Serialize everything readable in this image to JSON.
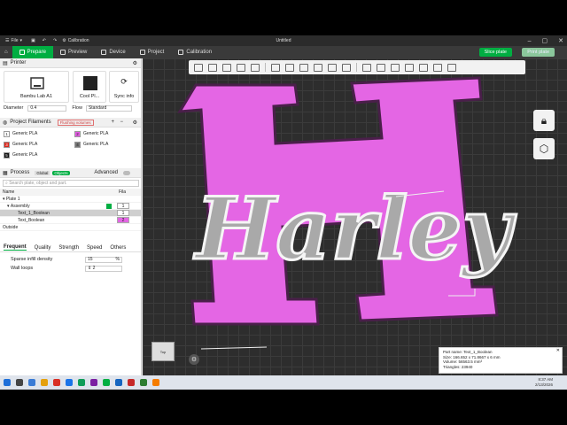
{
  "titlebar": {
    "file_menu": "File",
    "calibration_label": "Calibration",
    "window_title": "Untitled"
  },
  "tabs": [
    {
      "label": "Prepare"
    },
    {
      "label": "Preview"
    },
    {
      "label": "Device"
    },
    {
      "label": "Project"
    },
    {
      "label": "Calibration"
    }
  ],
  "actions": {
    "slice": "Slice plate",
    "print": "Print plate"
  },
  "printer": {
    "header": "Printer",
    "printer_name": "Bambu Lab A1",
    "plate_name": "Cool Pl...",
    "sync_label": "Sync info",
    "diameter_label": "Diameter",
    "diameter_value": "0.4",
    "flow_label": "Flow",
    "flow_value": "Standard"
  },
  "filaments": {
    "header": "Project Filaments",
    "badge": "Flushing volumes",
    "items": [
      {
        "num": "1",
        "name": "Generic PLA",
        "color": "#ffffff"
      },
      {
        "num": "2",
        "name": "Generic PLA",
        "color": "#e65ce6"
      },
      {
        "num": "3",
        "name": "Generic PLA",
        "color": "#d9261c"
      },
      {
        "num": "4",
        "name": "Generic PLA",
        "color": "#777777"
      },
      {
        "num": "5",
        "name": "Generic PLA",
        "color": "#111111"
      }
    ]
  },
  "process": {
    "header": "Process",
    "toggle_global": "Global",
    "toggle_objects": "Objects",
    "mode": "Advanced",
    "search_placeholder": "Search plate, object and part.",
    "col_name": "Name",
    "col_fila": "Fila",
    "tree": [
      {
        "label": "Plate 1",
        "fila": "",
        "indent": 0
      },
      {
        "label": "Assembly",
        "fila": "1",
        "indent": 1
      },
      {
        "label": "Text_1_Boolean",
        "fila": "1",
        "indent": 2
      },
      {
        "label": "Text_Boolean",
        "fila": "2",
        "indent": 2
      },
      {
        "label": "Outside",
        "fila": "",
        "indent": 0
      }
    ]
  },
  "prop_tabs": [
    "Frequent",
    "Quality",
    "Strength",
    "Speed",
    "Others"
  ],
  "settings": {
    "infill_label": "Sparse infill density",
    "infill_value": "15",
    "infill_unit": "%",
    "walls_label": "Wall loops",
    "walls_value": "2"
  },
  "model": {
    "letter": "H",
    "text": "Harley"
  },
  "part_info": {
    "name": "Part name: Text_1_Boolean",
    "size": "Size: 166.652 x 71.8667 x 6 mm",
    "volume": "Volume: 56563.5 mm³",
    "triangles": "Triangles: 23940"
  },
  "navcube_label": "Top",
  "clock": {
    "time": "8:37 AM",
    "date": "2/13/2026"
  },
  "colors": {
    "accent": "#00ae42",
    "model_pink": "#e466e4",
    "text_gray": "#a9a9a9"
  }
}
